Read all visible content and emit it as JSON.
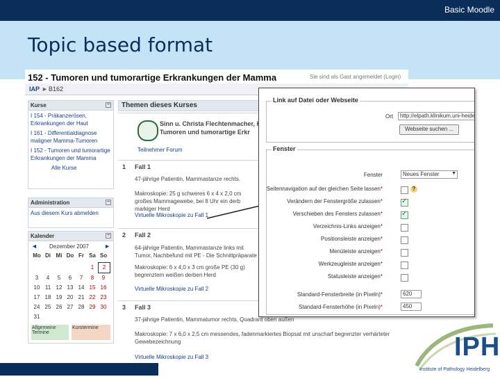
{
  "header": {
    "title": "Basic Moodle"
  },
  "slide": {
    "title": "Topic based format"
  },
  "moodle": {
    "course_title": "152 - Tumoren und tumorartige Erkrankungen der Mamma",
    "guest_text": "Sie sind als Gast angemeldet (Login)",
    "breadcrumb": {
      "root": "IAP",
      "sep": "►",
      "current": "B162"
    },
    "courses_block": {
      "title": "Kurse",
      "items": [
        "I 154 - Präkanzerösen, Erkrankungen der Haut",
        "I 161 - Differentialdiagnose maligner Mamma-Tumoren",
        "I 152 - Tumoren und tumorartige Erkrankungen der Mamma"
      ],
      "all": "Alle Kurse"
    },
    "admin_block": {
      "title": "Administration",
      "item": "Aus diesem Kurs abmelden"
    },
    "calendar": {
      "title": "Kalender",
      "month": "Dezember 2007",
      "prev": "◄",
      "next": "►",
      "days": [
        "Mo",
        "Di",
        "Mi",
        "Do",
        "Fr",
        "Sa",
        "So"
      ],
      "weeks": [
        [
          "",
          "",
          "",
          "",
          "",
          "1",
          "2"
        ],
        [
          "3",
          "4",
          "5",
          "6",
          "7",
          "8",
          "9"
        ],
        [
          "10",
          "11",
          "12",
          "13",
          "14",
          "15",
          "16"
        ],
        [
          "17",
          "18",
          "19",
          "20",
          "21",
          "22",
          "23"
        ],
        [
          "24",
          "25",
          "26",
          "27",
          "28",
          "29",
          "30"
        ],
        [
          "31",
          "",
          "",
          "",
          "",
          "",
          ""
        ]
      ],
      "legend_global": "Allgemeine Termine",
      "legend_course": "Kurstermine"
    },
    "topics": {
      "header": "Themen dieses Kurses",
      "intro_author": "Sinn u. Christa Flechtenmacher, H",
      "intro_title": "Tumoren und tumorartige Erkr",
      "intro_link": "Teilnehmer Forum",
      "sections": [
        {
          "num": "1",
          "title": "Fall 1",
          "text": "47-jährige Patientin, Mammastanze rechts.",
          "makro": "Makroskopie: 25 g schweres 6 x 4 x 2,0 cm großes Mammagewebe, bei 8 Uhr ein derb markiger Herd",
          "link": "Virtuelle Mikroskopie zu Fall 1"
        },
        {
          "num": "2",
          "title": "Fall 2",
          "text": "64-jährige Patientin, Mammastanze links mit Tumor, Nachbefund mit PE - Die Schnittpräparate",
          "makro": "Makroskopie: 6 x 4,0 x 3 cm große PE (30 g) begrenztem weißen derben Herd",
          "link": "Virtuelle Mikroskopie zu Fall 2"
        },
        {
          "num": "3",
          "title": "Fall 3",
          "text": "37-jährige Patientin, Mammatumor rechts, Quadrant oben außen",
          "makro": "Makroskopie: 7 x 6,0 x 2,5 cm messendes, fadenmarkiertes Biopsat mit unscharf begrenzter verhärteter Gewebezeichnung",
          "link": "Virtuelle Mikroskopie zu Fall 3"
        }
      ]
    },
    "dialog": {
      "link_legend": "Link auf Datei oder Webseite",
      "location_label": "Ort",
      "location_value": "http://elpath.klinikum.uni-heidelberg.de",
      "search_button": "Webseite suchen ...",
      "window_legend": "Fenster",
      "window_label": "Fenster",
      "window_value": "Neues Fenster",
      "rows": [
        {
          "label": "Seitennavigation auf der gleichen Seite lassen",
          "checked": false,
          "help": true
        },
        {
          "label": "Verändern der Fenstergröße zulassen",
          "checked": true
        },
        {
          "label": "Verschieben des Fensters zulassen",
          "checked": true
        },
        {
          "label": "Verzeichnis-Links anzeigen",
          "checked": false
        },
        {
          "label": "Positionsleiste anzeigen",
          "checked": false
        },
        {
          "label": "Menüleiste anzeigen",
          "checked": false
        },
        {
          "label": "Werkzeugleiste anzeigen",
          "checked": false
        },
        {
          "label": "Statusleiste anzeigen",
          "checked": false
        }
      ],
      "width_label": "Standard-Fensterbreite (in Pixeln)",
      "width_value": "620",
      "height_label": "Standard-Fensterhöhe (in Pixeln)",
      "height_value": "450"
    }
  },
  "logo": {
    "text": "IPH",
    "subtitle": "Institute of Pathology Heidelberg"
  },
  "colors": {
    "navy": "#0b2d5a",
    "band": "#c4e3f6",
    "logo_green": "#8fa866"
  }
}
